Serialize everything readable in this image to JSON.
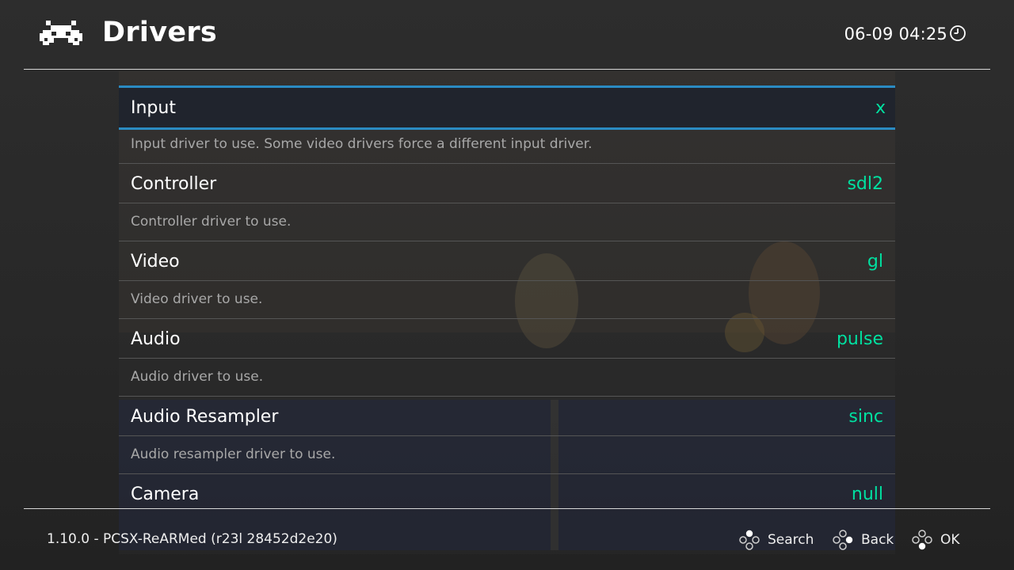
{
  "header": {
    "title": "Drivers",
    "clock": "06-09 04:25",
    "logo_icon": "retroarch-space-invader-icon",
    "clock_icon": "clock-icon"
  },
  "colors": {
    "accent_border": "#2a8bc2",
    "value_text": "#00e0a0",
    "sublabel_text": "#a8a8a8",
    "background": "#2b2b2b"
  },
  "items": [
    {
      "label": "Input",
      "value": "x",
      "description": "Input driver to use. Some video drivers force a different input driver.",
      "selected": true
    },
    {
      "label": "Controller",
      "value": "sdl2",
      "description": "Controller driver to use."
    },
    {
      "label": "Video",
      "value": "gl",
      "description": "Video driver to use."
    },
    {
      "label": "Audio",
      "value": "pulse",
      "description": "Audio driver to use."
    },
    {
      "label": "Audio Resampler",
      "value": "sinc",
      "description": "Audio resampler driver to use."
    },
    {
      "label": "Camera",
      "value": "null"
    }
  ],
  "footer": {
    "version": "1.10.0 - PCSX-ReARMed (r23l 28452d2e20)",
    "hints": [
      {
        "label": "Search",
        "icon": "gamepad-face-buttons-top-icon"
      },
      {
        "label": "Back",
        "icon": "gamepad-face-buttons-right-icon"
      },
      {
        "label": "OK",
        "icon": "gamepad-face-buttons-bottom-icon"
      }
    ]
  }
}
